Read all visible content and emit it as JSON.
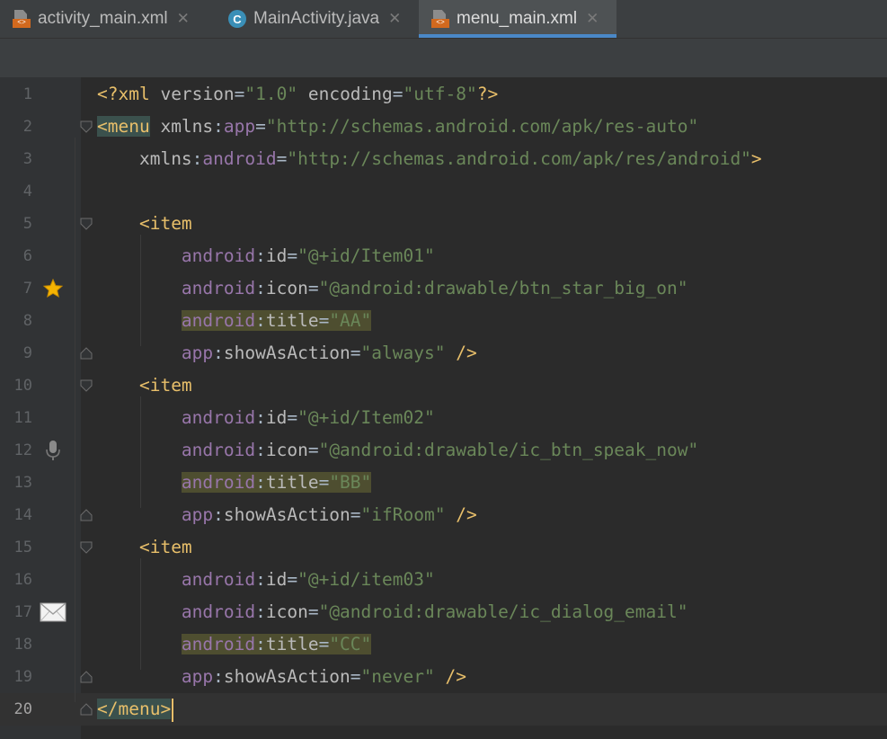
{
  "tabs": [
    {
      "label": "activity_main.xml",
      "icon": "xml-file-icon",
      "active": false
    },
    {
      "label": "MainActivity.java",
      "icon": "java-class-icon",
      "active": false
    },
    {
      "label": "menu_main.xml",
      "icon": "xml-file-icon",
      "active": true
    }
  ],
  "close_glyph": "✕",
  "editor": {
    "current_line": 20,
    "lines": [
      {
        "n": "1",
        "tokens": [
          [
            "prolog",
            "<?xml "
          ],
          [
            "attr",
            "version"
          ],
          [
            "plain",
            "="
          ],
          [
            "val",
            "\"1.0\""
          ],
          [
            "plain",
            " "
          ],
          [
            "attr",
            "encoding"
          ],
          [
            "plain",
            "="
          ],
          [
            "val",
            "\"utf-8\""
          ],
          [
            "prolog",
            "?>"
          ]
        ]
      },
      {
        "n": "2",
        "tokens": [
          [
            "tag-hl",
            "<menu"
          ],
          [
            "plain",
            " "
          ],
          [
            "attr",
            "xmlns"
          ],
          [
            "plain",
            ":"
          ],
          [
            "ns",
            "app"
          ],
          [
            "plain",
            "="
          ],
          [
            "val",
            "\"http://schemas.android.com/apk/res-auto\""
          ]
        ]
      },
      {
        "n": "3",
        "tokens": [
          [
            "plain",
            "    "
          ],
          [
            "attr",
            "xmlns"
          ],
          [
            "plain",
            ":"
          ],
          [
            "ns",
            "android"
          ],
          [
            "plain",
            "="
          ],
          [
            "val",
            "\"http://schemas.android.com/apk/res/android\""
          ],
          [
            "tag",
            ">"
          ]
        ]
      },
      {
        "n": "4",
        "tokens": []
      },
      {
        "n": "5",
        "tokens": [
          [
            "plain",
            "    "
          ],
          [
            "tag",
            "<item"
          ]
        ]
      },
      {
        "n": "6",
        "tokens": [
          [
            "plain",
            "        "
          ],
          [
            "ns",
            "android"
          ],
          [
            "plain",
            ":"
          ],
          [
            "attr",
            "id"
          ],
          [
            "plain",
            "="
          ],
          [
            "val",
            "\"@+id/Item01\""
          ]
        ]
      },
      {
        "n": "7",
        "tokens": [
          [
            "plain",
            "        "
          ],
          [
            "ns",
            "android"
          ],
          [
            "plain",
            ":"
          ],
          [
            "attr",
            "icon"
          ],
          [
            "plain",
            "="
          ],
          [
            "val",
            "\"@android:drawable/btn_star_big_on\""
          ]
        ]
      },
      {
        "n": "8",
        "tokens": [
          [
            "plain",
            "        "
          ],
          [
            "ns-hl",
            "android"
          ],
          [
            "plain-hl",
            ":"
          ],
          [
            "attr-hl",
            "title"
          ],
          [
            "plain-hl",
            "="
          ],
          [
            "val-hl",
            "\"AA\""
          ]
        ]
      },
      {
        "n": "9",
        "tokens": [
          [
            "plain",
            "        "
          ],
          [
            "ns",
            "app"
          ],
          [
            "plain",
            ":"
          ],
          [
            "attr",
            "showAsAction"
          ],
          [
            "plain",
            "="
          ],
          [
            "val",
            "\"always\""
          ],
          [
            "plain",
            " "
          ],
          [
            "tag",
            "/>"
          ]
        ]
      },
      {
        "n": "10",
        "tokens": [
          [
            "plain",
            "    "
          ],
          [
            "tag",
            "<item"
          ]
        ]
      },
      {
        "n": "11",
        "tokens": [
          [
            "plain",
            "        "
          ],
          [
            "ns",
            "android"
          ],
          [
            "plain",
            ":"
          ],
          [
            "attr",
            "id"
          ],
          [
            "plain",
            "="
          ],
          [
            "val",
            "\"@+id/Item02\""
          ]
        ]
      },
      {
        "n": "12",
        "tokens": [
          [
            "plain",
            "        "
          ],
          [
            "ns",
            "android"
          ],
          [
            "plain",
            ":"
          ],
          [
            "attr",
            "icon"
          ],
          [
            "plain",
            "="
          ],
          [
            "val",
            "\"@android:drawable/ic_btn_speak_now\""
          ]
        ]
      },
      {
        "n": "13",
        "tokens": [
          [
            "plain",
            "        "
          ],
          [
            "ns-hl",
            "android"
          ],
          [
            "plain-hl",
            ":"
          ],
          [
            "attr-hl",
            "title"
          ],
          [
            "plain-hl",
            "="
          ],
          [
            "val-hl",
            "\"BB\""
          ]
        ]
      },
      {
        "n": "14",
        "tokens": [
          [
            "plain",
            "        "
          ],
          [
            "ns",
            "app"
          ],
          [
            "plain",
            ":"
          ],
          [
            "attr",
            "showAsAction"
          ],
          [
            "plain",
            "="
          ],
          [
            "val",
            "\"ifRoom\""
          ],
          [
            "plain",
            " "
          ],
          [
            "tag",
            "/>"
          ]
        ]
      },
      {
        "n": "15",
        "tokens": [
          [
            "plain",
            "    "
          ],
          [
            "tag",
            "<item"
          ]
        ]
      },
      {
        "n": "16",
        "tokens": [
          [
            "plain",
            "        "
          ],
          [
            "ns",
            "android"
          ],
          [
            "plain",
            ":"
          ],
          [
            "attr",
            "id"
          ],
          [
            "plain",
            "="
          ],
          [
            "val",
            "\"@+id/item03\""
          ]
        ]
      },
      {
        "n": "17",
        "tokens": [
          [
            "plain",
            "        "
          ],
          [
            "ns",
            "android"
          ],
          [
            "plain",
            ":"
          ],
          [
            "attr",
            "icon"
          ],
          [
            "plain",
            "="
          ],
          [
            "val",
            "\"@android:drawable/ic_dialog_email\""
          ]
        ]
      },
      {
        "n": "18",
        "tokens": [
          [
            "plain",
            "        "
          ],
          [
            "ns-hl",
            "android"
          ],
          [
            "plain-hl",
            ":"
          ],
          [
            "attr-hl",
            "title"
          ],
          [
            "plain-hl",
            "="
          ],
          [
            "val-hl",
            "\"CC\""
          ]
        ]
      },
      {
        "n": "19",
        "tokens": [
          [
            "plain",
            "        "
          ],
          [
            "ns",
            "app"
          ],
          [
            "plain",
            ":"
          ],
          [
            "attr",
            "showAsAction"
          ],
          [
            "plain",
            "="
          ],
          [
            "val",
            "\"never\""
          ],
          [
            "plain",
            " "
          ],
          [
            "tag",
            "/>"
          ]
        ]
      },
      {
        "n": "20",
        "tokens": [
          [
            "tag-hl",
            "</menu>"
          ]
        ]
      }
    ]
  },
  "gutter_icons": [
    {
      "line": 7,
      "icon": "star-icon"
    },
    {
      "line": 12,
      "icon": "microphone-icon"
    },
    {
      "line": 17,
      "icon": "envelope-icon"
    }
  ],
  "fold_markers": [
    {
      "line": 2,
      "kind": "open"
    },
    {
      "line": 5,
      "kind": "open"
    },
    {
      "line": 9,
      "kind": "close"
    },
    {
      "line": 10,
      "kind": "open"
    },
    {
      "line": 14,
      "kind": "close"
    },
    {
      "line": 15,
      "kind": "open"
    },
    {
      "line": 19,
      "kind": "close"
    },
    {
      "line": 20,
      "kind": "close"
    }
  ],
  "colors": {
    "background": "#2b2b2b",
    "tag": "#e8bf6a",
    "namespace": "#9876aa",
    "attribute": "#bababa",
    "value": "#6a8759",
    "tab_underline": "#4a88c7"
  }
}
